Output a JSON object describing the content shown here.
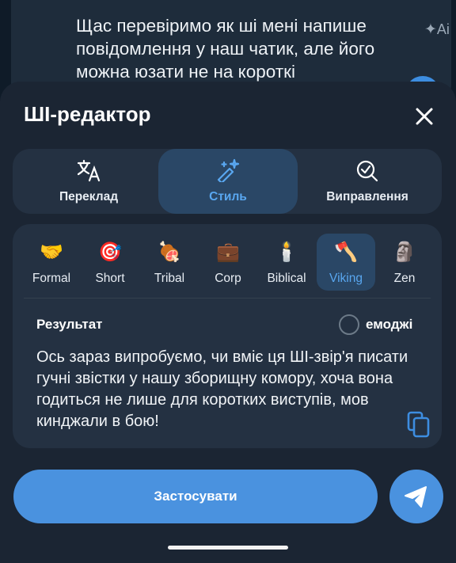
{
  "background_message": {
    "text": "Щас перевіримо як ші мені напише повідомлення у наш чатик, але його можна юзати не на короткі",
    "ai_icon": "ai-sparkle-icon"
  },
  "sheet": {
    "title": "ШІ-редактор",
    "close_icon": "close-icon"
  },
  "modes": [
    {
      "label": "Переклад",
      "icon": "translate-icon",
      "active": false
    },
    {
      "label": "Стиль",
      "icon": "magic-wand-icon",
      "active": true
    },
    {
      "label": "Виправлення",
      "icon": "spell-check-icon",
      "active": false
    }
  ],
  "styles": [
    {
      "emoji": "🤝",
      "label": "Formal",
      "active": false
    },
    {
      "emoji": "🎯",
      "label": "Short",
      "active": false
    },
    {
      "emoji": "🍖",
      "label": "Tribal",
      "active": false
    },
    {
      "emoji": "💼",
      "label": "Corp",
      "active": false
    },
    {
      "emoji": "🕯️",
      "label": "Biblical",
      "active": false
    },
    {
      "emoji": "🪓",
      "label": "Viking",
      "active": true
    },
    {
      "emoji": "🗿",
      "label": "Zen",
      "active": false
    }
  ],
  "result": {
    "title": "Результат",
    "emoji_option": "емоджі",
    "emoji_checked": false,
    "text": "Ось зараз випробуємо, чи вміє ця ШІ-звір'я писати гучні звістки у нашу зборищну комору, хоча вона годиться не лише для коротких виступів, мов кинджали в бою!",
    "copy_icon": "copy-icon"
  },
  "actions": {
    "apply_label": "Застосувати",
    "send_icon": "send-icon"
  },
  "colors": {
    "accent": "#4a92df",
    "active_text": "#59a7f0",
    "sheet_bg": "#1b2533",
    "card_bg": "#243142"
  }
}
